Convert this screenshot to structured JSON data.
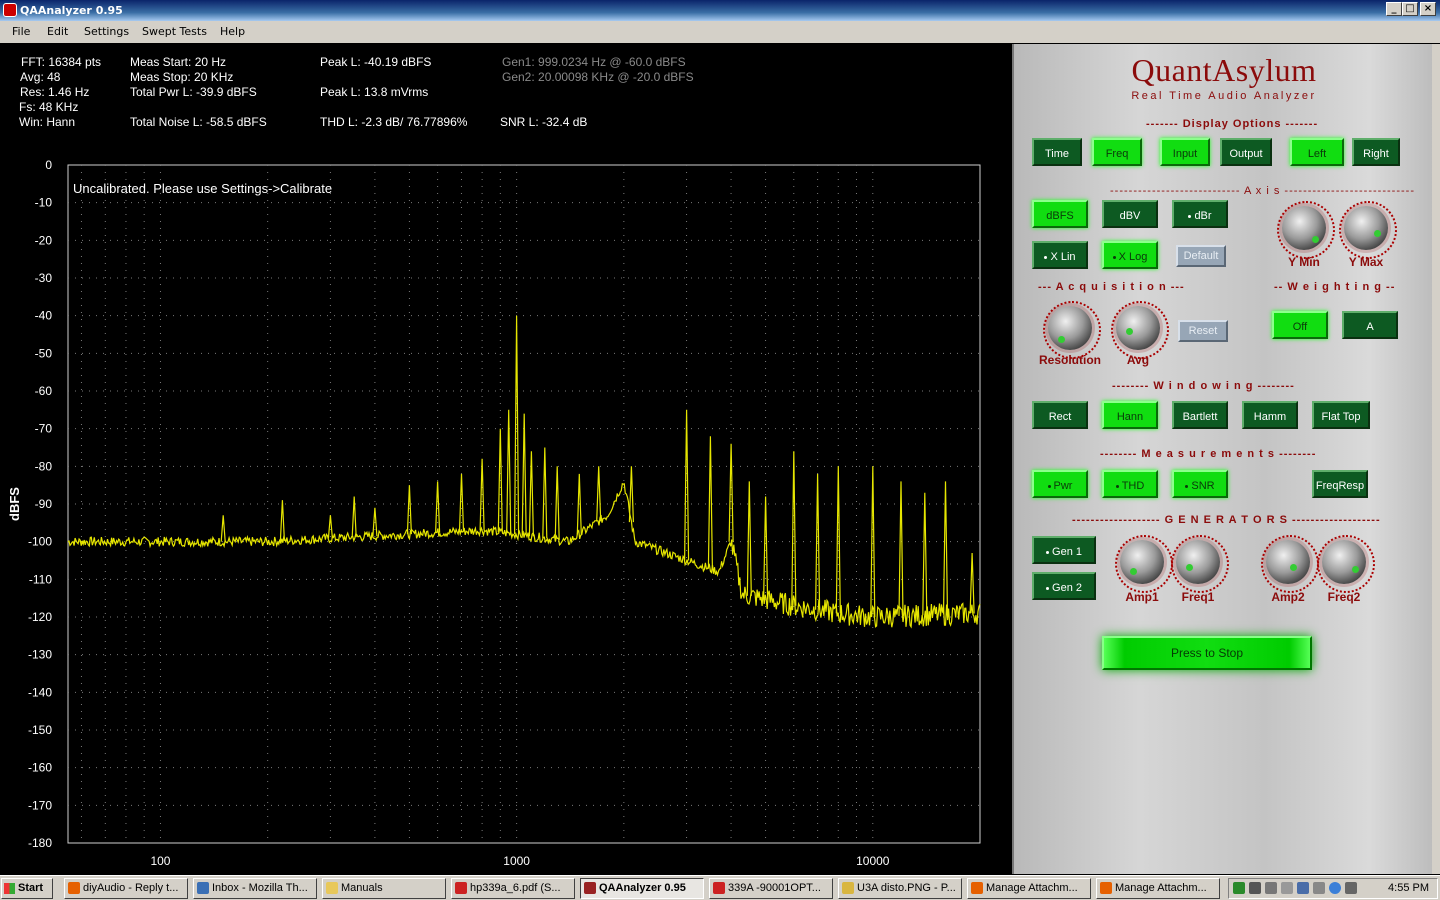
{
  "window": {
    "title": "QAAnalyzer 0.95",
    "controls": [
      "_",
      "□",
      "×"
    ]
  },
  "menu": [
    "File",
    "Edit",
    "Settings",
    "Swept Tests",
    "Help"
  ],
  "readouts": {
    "fft": "FFT: 16384 pts",
    "avg": "Avg: 48",
    "res": "Res: 1.46 Hz",
    "fs": "Fs: 48 KHz",
    "win": "Win: Hann",
    "meas_start": "Meas Start: 20 Hz",
    "meas_stop": "Meas Stop: 20 KHz",
    "total_pwr": "Total Pwr L: -39.9 dBFS",
    "total_noise": "Total Noise L: -58.5 dBFS",
    "peak_dbfs": "Peak L: -40.19 dBFS",
    "peak_mvrms": "Peak L: 13.8 mVrms",
    "thd": "THD L: -2.3 dB/ 76.77896%",
    "gen1": "Gen1: 999.0234 Hz @ -60.0 dBFS",
    "gen2": "Gen2: 20.00098 KHz @ -20.0 dBFS",
    "snr": "SNR L: -32.4 dB"
  },
  "plot": {
    "annotation": "Uncalibrated. Please use Settings->Calibrate",
    "trace_color": "#e6e600"
  },
  "chart_data": {
    "type": "line",
    "xlabel": "",
    "ylabel": "dBFS",
    "xscale": "log",
    "xlim": [
      55,
      20000
    ],
    "ylim": [
      -180,
      0
    ],
    "xticks": [
      100,
      1000,
      10000
    ],
    "xtick_labels": [
      "100",
      "1000",
      "10000"
    ],
    "yticks": [
      0,
      -10,
      -20,
      -30,
      -40,
      -50,
      -60,
      -70,
      -80,
      -90,
      -100,
      -110,
      -120,
      -130,
      -140,
      -150,
      -160,
      -170,
      -180
    ],
    "ytick_labels": [
      "0",
      "-10",
      "-20",
      "-30",
      "-40",
      "-50",
      "-60",
      "-70",
      "-80",
      "-90",
      "-100",
      "-110",
      "-120",
      "-130",
      "-140",
      "-150",
      "-160",
      "-170",
      "-180"
    ],
    "grid": true,
    "noise_floor": [
      [
        55,
        -100
      ],
      [
        200,
        -100
      ],
      [
        500,
        -98
      ],
      [
        800,
        -97
      ],
      [
        1000,
        -98
      ],
      [
        1400,
        -100
      ],
      [
        1800,
        -93
      ],
      [
        2000,
        -84
      ],
      [
        2150,
        -100
      ],
      [
        3000,
        -105
      ],
      [
        3700,
        -108
      ],
      [
        4000,
        -100
      ],
      [
        4300,
        -114
      ],
      [
        6000,
        -117
      ],
      [
        8000,
        -119
      ],
      [
        10000,
        -120
      ],
      [
        20000,
        -119
      ]
    ],
    "peaks": [
      [
        60,
        -100
      ],
      [
        150,
        -93
      ],
      [
        220,
        -89
      ],
      [
        300,
        -93
      ],
      [
        350,
        -88
      ],
      [
        400,
        -91
      ],
      [
        500,
        -85
      ],
      [
        600,
        -84
      ],
      [
        700,
        -82
      ],
      [
        800,
        -78
      ],
      [
        900,
        -70
      ],
      [
        950,
        -65
      ],
      [
        1000,
        -40
      ],
      [
        1050,
        -66
      ],
      [
        1100,
        -76
      ],
      [
        1200,
        -75
      ],
      [
        1300,
        -80
      ],
      [
        1500,
        -82
      ],
      [
        1700,
        -80
      ],
      [
        2100,
        -80
      ],
      [
        3000,
        -65
      ],
      [
        3500,
        -72
      ],
      [
        4000,
        -74
      ],
      [
        4500,
        -84
      ],
      [
        5000,
        -88
      ],
      [
        6000,
        -76
      ],
      [
        7000,
        -82
      ],
      [
        8000,
        -80
      ],
      [
        10000,
        -80
      ],
      [
        12000,
        -84
      ],
      [
        14000,
        -87
      ],
      [
        16000,
        -84
      ],
      [
        19000,
        -103
      ]
    ]
  },
  "panel": {
    "logo": "QuantAsylum",
    "tagline": "Real Time Audio Analyzer",
    "sections": {
      "display": "------- Display Options -------",
      "axis": "---------------------------- A x i s ----------------------------",
      "acquisition": "--- A c q u i s i t i o n ---",
      "weighting": "-- W e i g h t i n g --",
      "windowing": "--------  W i n d o w i n g  --------",
      "measurements": "--------  M e a s u r e m e n t s --------",
      "generators": "-------------------  G E N E R A T O R S  -------------------"
    },
    "display_buttons": [
      "Time",
      "Freq",
      "Input",
      "Output",
      "Left",
      "Right"
    ],
    "axis_buttons": [
      "dBFS",
      "dBV",
      "dBr"
    ],
    "xscale_buttons": [
      "X Lin",
      "X Log"
    ],
    "default_button": "Default",
    "reset_button": "Reset",
    "weighting_buttons": [
      "Off",
      "A"
    ],
    "window_buttons": [
      "Rect",
      "Hann",
      "Bartlett",
      "Hamm",
      "Flat Top"
    ],
    "measure_buttons": [
      "Pwr",
      "THD",
      "SNR",
      "FreqResp"
    ],
    "gen_buttons": [
      "Gen 1",
      "Gen 2"
    ],
    "knobs": {
      "ymin": "Y Min",
      "ymax": "Y Max",
      "resolution": "Resolution",
      "avg": "Avg",
      "amp1": "Amp1",
      "freq1": "Freq1",
      "amp2": "Amp2",
      "freq2": "Freq2"
    },
    "stop_button": "Press to Stop",
    "active_color": "#11dd11",
    "inactive_color": "#0d5a22"
  },
  "taskbar": {
    "start": "Start",
    "tasks": [
      "diyAudio - Reply t...",
      "Inbox - Mozilla Th...",
      "Manuals",
      "hp339a_6.pdf (S...",
      "QAAnalyzer 0.95",
      "339A -90001OPT...",
      "U3A disto.PNG - P...",
      "Manage Attachm...",
      "Manage Attachm..."
    ],
    "clock": "4:55 PM"
  }
}
